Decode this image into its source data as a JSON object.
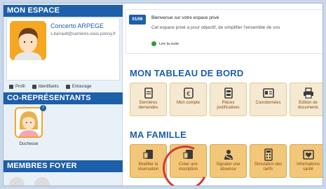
{
  "sidebar": {
    "mon_espace_title": "MON ESPACE",
    "user_name": "Concerto ARPEGE",
    "user_email": "s.barrault@carrieres-sous-poissy.fr",
    "links": [
      {
        "label": "Profil",
        "icon": "person-icon"
      },
      {
        "label": "Identifiants",
        "icon": "lock-icon"
      },
      {
        "label": "Entourage",
        "icon": "list-icon"
      }
    ],
    "corep_title": "CO-REPRÉSENTANTS",
    "corep_name": "Duchesse",
    "membres_title": "MEMBRES FOYER"
  },
  "news": {
    "date": "01/06",
    "title": "Bienvenue sur votre espace privé",
    "text": "Cet espace privé a pour objectif, de simplifier l'ensemble de vos",
    "read_more": "Lire la suite"
  },
  "dashboard": {
    "title": "MON TABLEAU DE BORD",
    "tiles": [
      {
        "label": "Dernières demandes",
        "icon": "document-icon"
      },
      {
        "label": "Mon compte",
        "icon": "euro-icon"
      },
      {
        "label": "Pièces justificatives",
        "icon": "file-stack-icon"
      },
      {
        "label": "Coordonnées",
        "icon": "contact-card-icon"
      },
      {
        "label": "Edition de documents",
        "icon": "printer-icon"
      }
    ]
  },
  "famille": {
    "title": "MA FAMILLE",
    "tiles": [
      {
        "label": "Modifier la réservation",
        "icon": "edit-form-icon"
      },
      {
        "label": "Créer une inscription",
        "icon": "add-form-icon"
      },
      {
        "label": "Signaler une absence",
        "icon": "absence-icon"
      },
      {
        "label": "Simulation des tarifs",
        "icon": "calculator-icon"
      },
      {
        "label": "Informations santé",
        "icon": "health-icon"
      }
    ]
  },
  "colors": {
    "primary": "#1d5fa8",
    "tile_bg": "#f6e9d2",
    "accent": "#f5a623",
    "mark": "#d33a3a"
  }
}
